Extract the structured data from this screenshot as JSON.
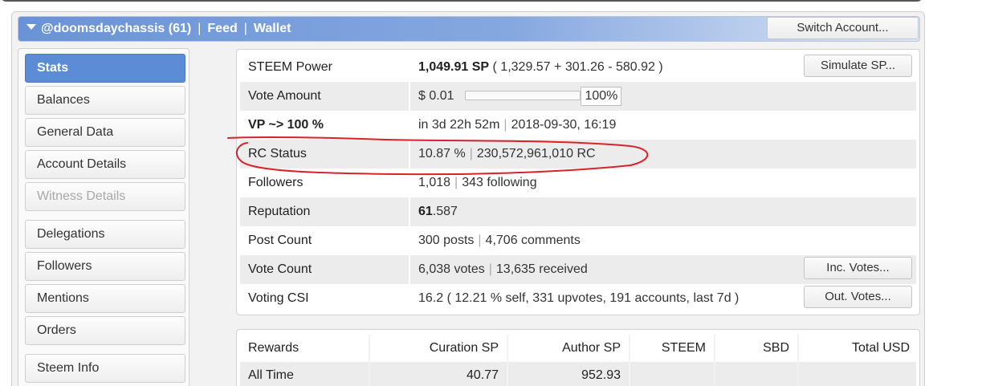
{
  "header": {
    "account": "@doomsdaychassis (61)",
    "links": [
      "Feed",
      "Wallet"
    ],
    "switch_button": "Switch Account..."
  },
  "sidebar": {
    "items": [
      {
        "label": "Stats",
        "state": "active"
      },
      {
        "label": "Balances",
        "state": "normal"
      },
      {
        "label": "General Data",
        "state": "normal"
      },
      {
        "label": "Account Details",
        "state": "normal"
      },
      {
        "label": "Witness Details",
        "state": "disabled"
      },
      {
        "label": "Delegations",
        "state": "normal"
      },
      {
        "label": "Followers",
        "state": "normal"
      },
      {
        "label": "Mentions",
        "state": "normal"
      },
      {
        "label": "Orders",
        "state": "normal"
      },
      {
        "label": "Steem Info",
        "state": "normal"
      }
    ]
  },
  "stats": {
    "steem_power": {
      "label": "STEEM Power",
      "value_bold": "1,049.91 SP",
      "value_rest": " ( 1,329.57 + 301.26 - 580.92 )",
      "button": "Simulate SP..."
    },
    "vote_amount": {
      "label": "Vote Amount",
      "value": "$ 0.01",
      "percent": "100%",
      "slider_fraction": 1.0
    },
    "vp": {
      "label": "VP ~> 100 %",
      "time": "in 3d 22h 52m",
      "datetime": "2018-09-30, 16:19"
    },
    "rc_status": {
      "label": "RC Status",
      "percent": "10.87 %",
      "rc": "230,572,961,010 RC"
    },
    "followers": {
      "label": "Followers",
      "count": "1,018",
      "following": "343 following"
    },
    "reputation": {
      "label": "Reputation",
      "value_bold": "61",
      "value_rest": ".587"
    },
    "post_count": {
      "label": "Post Count",
      "posts": "300 posts",
      "comments": "4,706 comments"
    },
    "vote_count": {
      "label": "Vote Count",
      "votes": "6,038 votes",
      "received": "13,635 received",
      "button": "Inc. Votes..."
    },
    "voting_csi": {
      "label": "Voting CSI",
      "value": "16.2 ( 12.21 % self, 331 upvotes, 191 accounts, last 7d )",
      "button": "Out. Votes..."
    }
  },
  "rewards": {
    "headers": [
      "Rewards",
      "Curation SP",
      "Author SP",
      "STEEM",
      "SBD",
      "Total USD"
    ],
    "rows": [
      {
        "label": "All Time",
        "curation_sp": "40.77",
        "author_sp": "952.93",
        "steem": "",
        "sbd": "",
        "total_usd": ""
      }
    ]
  },
  "colors": {
    "header_gradient_start": "#6a93d6",
    "active_tab": "#5d8cd7",
    "annotation_stroke": "#d8232a"
  }
}
